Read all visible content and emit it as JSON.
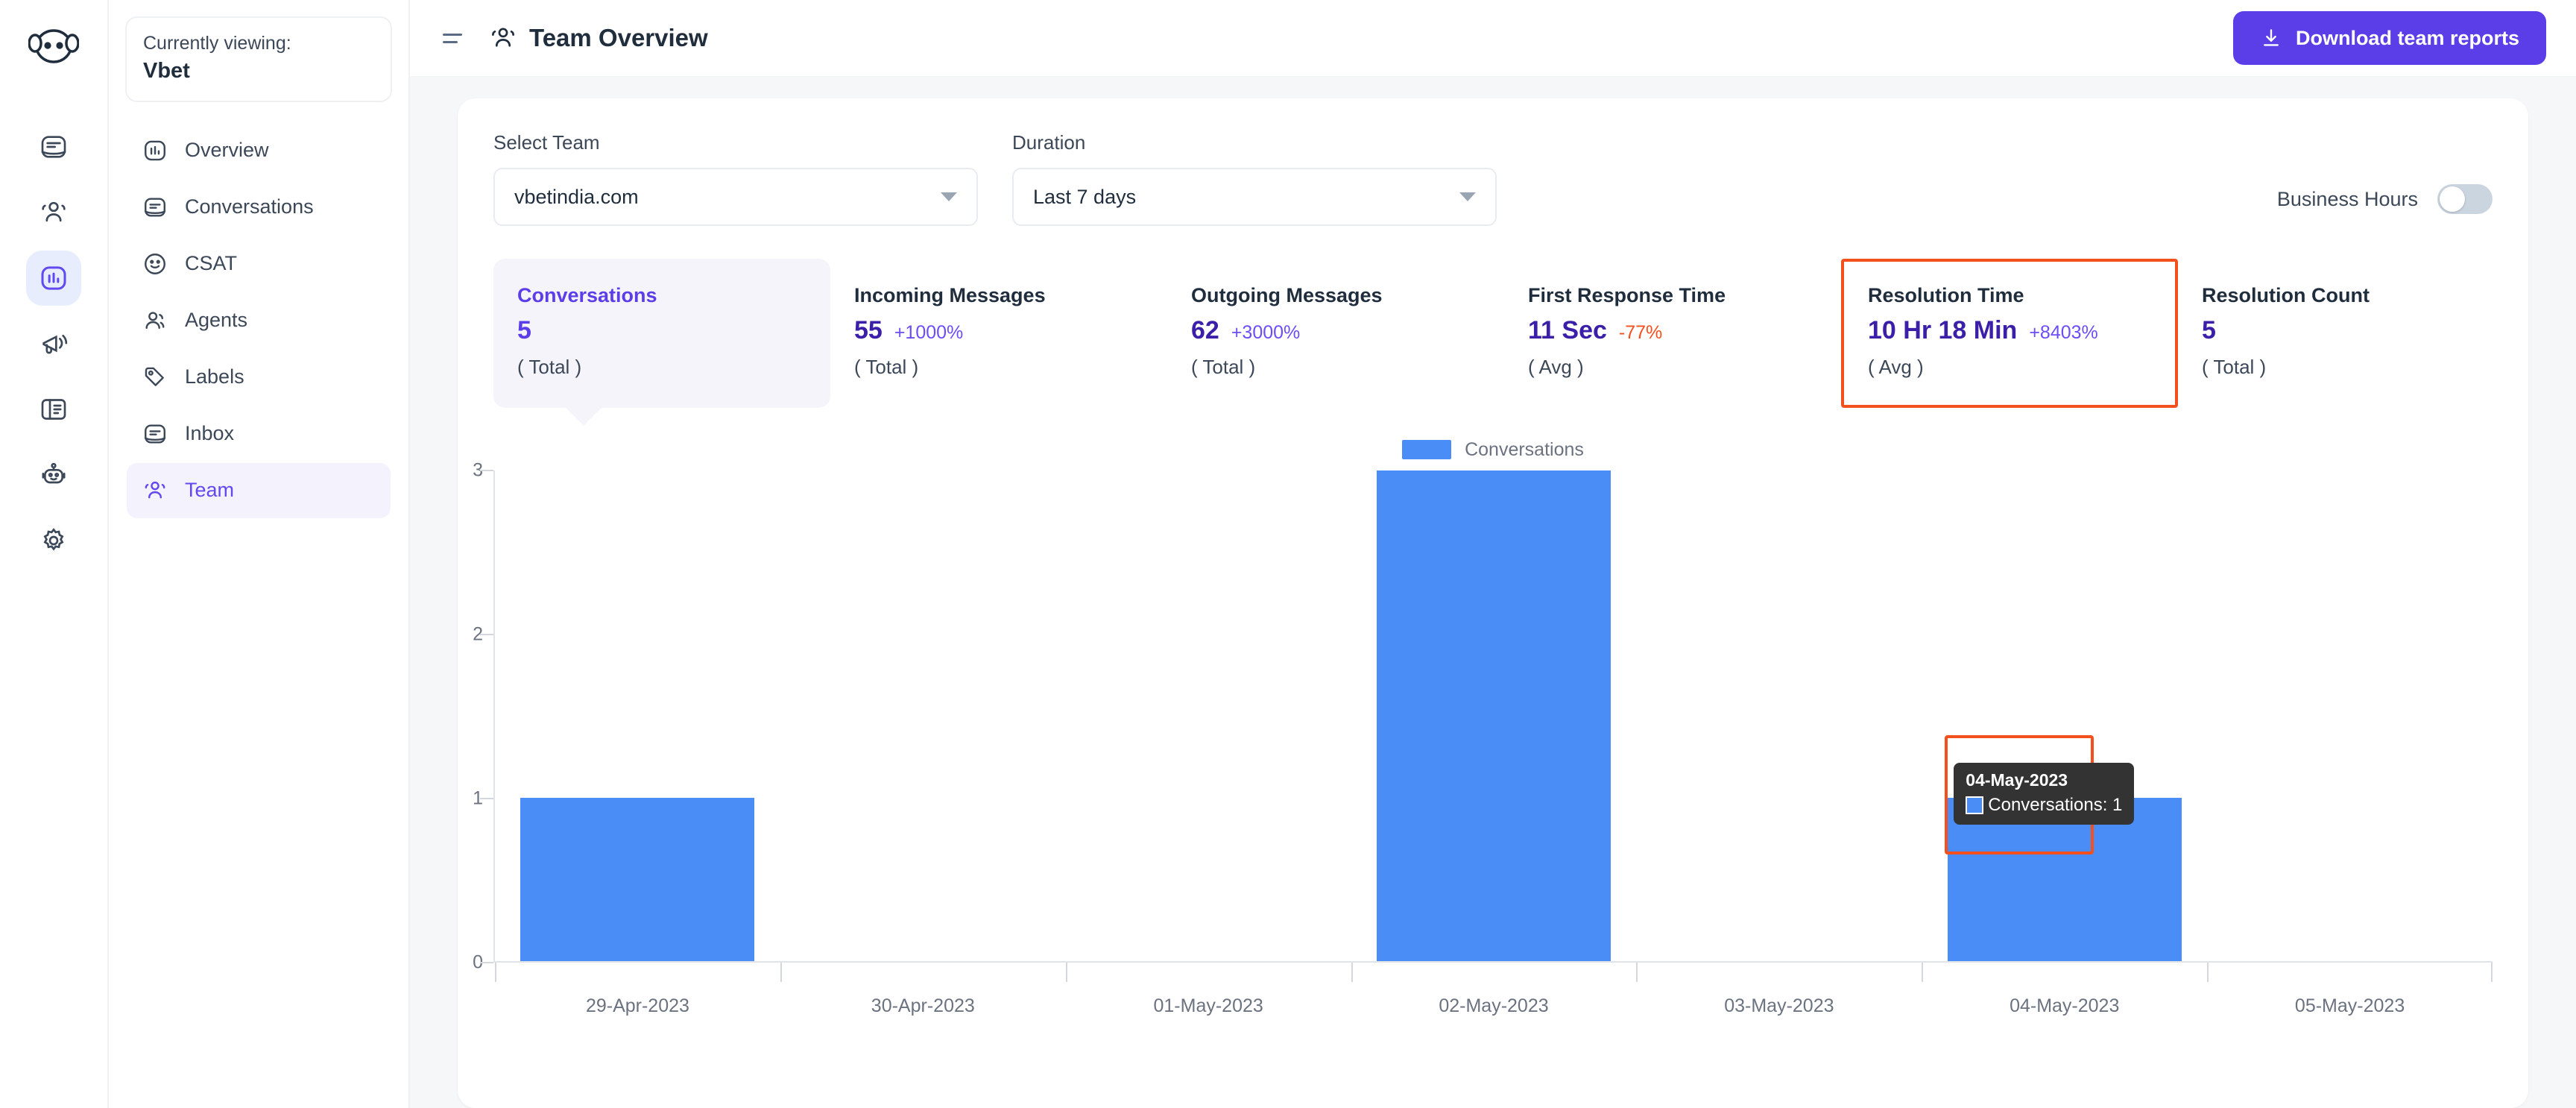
{
  "rail": {
    "logo_icon": "chatwoot-logo-icon",
    "items": [
      {
        "icon": "conversations-icon",
        "active": false
      },
      {
        "icon": "contacts-icon",
        "active": false
      },
      {
        "icon": "reports-icon",
        "active": true
      },
      {
        "icon": "campaigns-icon",
        "active": false
      },
      {
        "icon": "portal-icon",
        "active": false
      },
      {
        "icon": "bot-icon",
        "active": false
      },
      {
        "icon": "settings-icon",
        "active": false
      }
    ]
  },
  "sidebar": {
    "viewing_label": "Currently viewing:",
    "viewing_name": "Vbet",
    "items": [
      {
        "label": "Overview",
        "icon": "bar-chart-icon",
        "active": false
      },
      {
        "label": "Conversations",
        "icon": "conversations-icon",
        "active": false
      },
      {
        "label": "CSAT",
        "icon": "smiley-icon",
        "active": false
      },
      {
        "label": "Agents",
        "icon": "agent-icon",
        "active": false
      },
      {
        "label": "Labels",
        "icon": "label-tag-icon",
        "active": false
      },
      {
        "label": "Inbox",
        "icon": "inbox-icon",
        "active": false
      },
      {
        "label": "Team",
        "icon": "team-icon",
        "active": true
      }
    ]
  },
  "header": {
    "menu_icon": "hamburger-icon",
    "title_icon": "team-icon",
    "title": "Team Overview",
    "download_icon": "download-icon",
    "download_label": "Download team reports"
  },
  "filters": {
    "team": {
      "label": "Select Team",
      "value": "vbetindia.com",
      "caret_icon": "chevron-down-icon"
    },
    "duration": {
      "label": "Duration",
      "value": "Last 7 days",
      "caret_icon": "chevron-down-icon"
    },
    "business_hours": {
      "label": "Business Hours",
      "enabled": false
    }
  },
  "metrics": [
    {
      "title": "Conversations",
      "value": "5",
      "delta": "",
      "delta_dir": "none",
      "sub": "( Total )",
      "selected": true,
      "outlined": false
    },
    {
      "title": "Incoming Messages",
      "value": "55",
      "delta": "+1000%",
      "delta_dir": "up",
      "sub": "( Total )",
      "selected": false,
      "outlined": false
    },
    {
      "title": "Outgoing Messages",
      "value": "62",
      "delta": "+3000%",
      "delta_dir": "up",
      "sub": "( Total )",
      "selected": false,
      "outlined": false
    },
    {
      "title": "First Response Time",
      "value": "11 Sec",
      "delta": "-77%",
      "delta_dir": "down",
      "sub": "( Avg )",
      "selected": false,
      "outlined": false
    },
    {
      "title": "Resolution Time",
      "value": "10 Hr 18 Min",
      "delta": "+8403%",
      "delta_dir": "up",
      "sub": "( Avg )",
      "selected": false,
      "outlined": true
    },
    {
      "title": "Resolution Count",
      "value": "5",
      "delta": "",
      "delta_dir": "none",
      "sub": "( Total )",
      "selected": false,
      "outlined": false
    }
  ],
  "tooltip": {
    "title": "04-May-2023",
    "series_label": "Conversations: 1",
    "swatch_color": "#4a8df6"
  },
  "colors": {
    "accent": "#5b3ee8",
    "bar": "#4a8df6",
    "highlight_outline": "#f4501e",
    "delta_up": "#6d4df5",
    "delta_down": "#f4501e"
  },
  "chart_data": {
    "type": "bar",
    "title": "",
    "categories": [
      "29-Apr-2023",
      "30-Apr-2023",
      "01-May-2023",
      "02-May-2023",
      "03-May-2023",
      "04-May-2023",
      "05-May-2023"
    ],
    "series": [
      {
        "name": "Conversations",
        "values": [
          1,
          0,
          0,
          3,
          0,
          1,
          0
        ],
        "color": "#4a8df6"
      }
    ],
    "xlabel": "",
    "ylabel": "",
    "ylim": [
      0,
      3
    ],
    "yticks": [
      0,
      1,
      2,
      3
    ],
    "grid": false,
    "legend": {
      "position": "top-center",
      "entries": [
        "Conversations"
      ]
    }
  }
}
